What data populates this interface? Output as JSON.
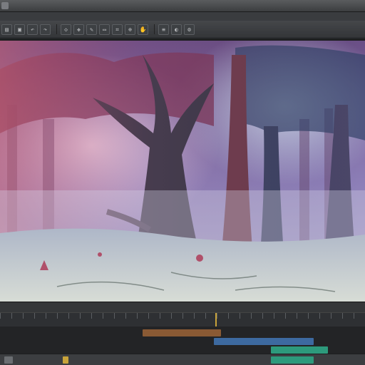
{
  "window": {
    "title": ""
  },
  "menu": [],
  "toolbar": {
    "buttons": [
      {
        "icon": "folder-icon",
        "glyph": "▤"
      },
      {
        "icon": "save-icon",
        "glyph": "▣"
      },
      {
        "icon": "undo-icon",
        "glyph": "↶"
      },
      {
        "icon": "redo-icon",
        "glyph": "↷"
      },
      {
        "icon": "select-icon",
        "glyph": "◇"
      },
      {
        "icon": "move-icon",
        "glyph": "✥"
      },
      {
        "icon": "brush-icon",
        "glyph": "✎"
      },
      {
        "icon": "eraser-icon",
        "glyph": "▭"
      },
      {
        "icon": "crop-icon",
        "glyph": "⌗"
      },
      {
        "icon": "zoom-icon",
        "glyph": "⊕"
      },
      {
        "icon": "hand-icon",
        "glyph": "✋"
      },
      {
        "icon": "layers-icon",
        "glyph": "≡"
      },
      {
        "icon": "color-icon",
        "glyph": "◐"
      },
      {
        "icon": "settings-icon",
        "glyph": "⚙"
      }
    ]
  },
  "canvas": {
    "scene": "misty forest with large trees and water",
    "colors": {
      "sky": "#7a6aa8",
      "mist": "#b9b2d6",
      "water": "#c9d0cf"
    }
  },
  "status": {
    "text": "",
    "zoom": ""
  },
  "timeline": {
    "playhead_fraction": 0.59
  },
  "colors": {
    "accent": "#c8a33a",
    "panel": "#2b2d30",
    "clip_a": "#8a5a34",
    "clip_b": "#3d6aa0",
    "clip_c": "#2d9a7c"
  }
}
